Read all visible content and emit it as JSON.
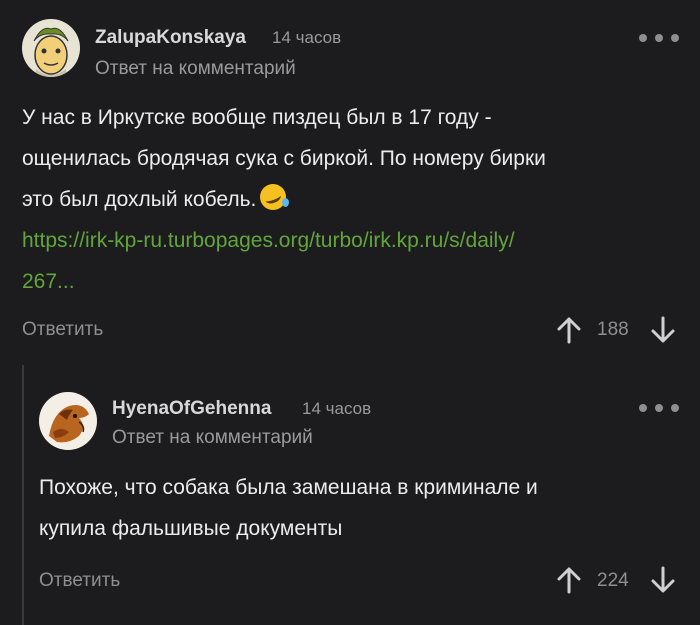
{
  "comments": [
    {
      "username": "ZalupaKonskaya",
      "time": "14 часов",
      "reply_meta": "Ответ на комментарий",
      "text_lines": [
        "У нас в Иркутске вообще пиздец был в 17 году -",
        "ощенилась бродячая сука с биркой. По номеру бирки",
        "это был дохлый кобель."
      ],
      "emoji": "rolling-on-floor-laughing-emoji",
      "link_lines": [
        "https://irk-kp-ru.turbopages.org/turbo/irk.kp.ru/s/daily/",
        "267..."
      ],
      "reply_label": "Ответить",
      "score": "188",
      "icons": {
        "more": "more-dots-icon",
        "up": "arrow-up-icon",
        "down": "arrow-down-icon"
      }
    },
    {
      "username": "HyenaOfGehenna",
      "time": "14 часов",
      "reply_meta": "Ответ на комментарий",
      "text_lines": [
        "Похоже, что собака была замешана в криминале и",
        "купила фальшивые документы"
      ],
      "reply_label": "Ответить",
      "score": "224",
      "icons": {
        "more": "more-dots-icon",
        "up": "arrow-up-icon",
        "down": "arrow-down-icon"
      }
    }
  ],
  "colors": {
    "background": "#1c1c1e",
    "link": "#62a53a",
    "muted": "#8e8e93"
  }
}
